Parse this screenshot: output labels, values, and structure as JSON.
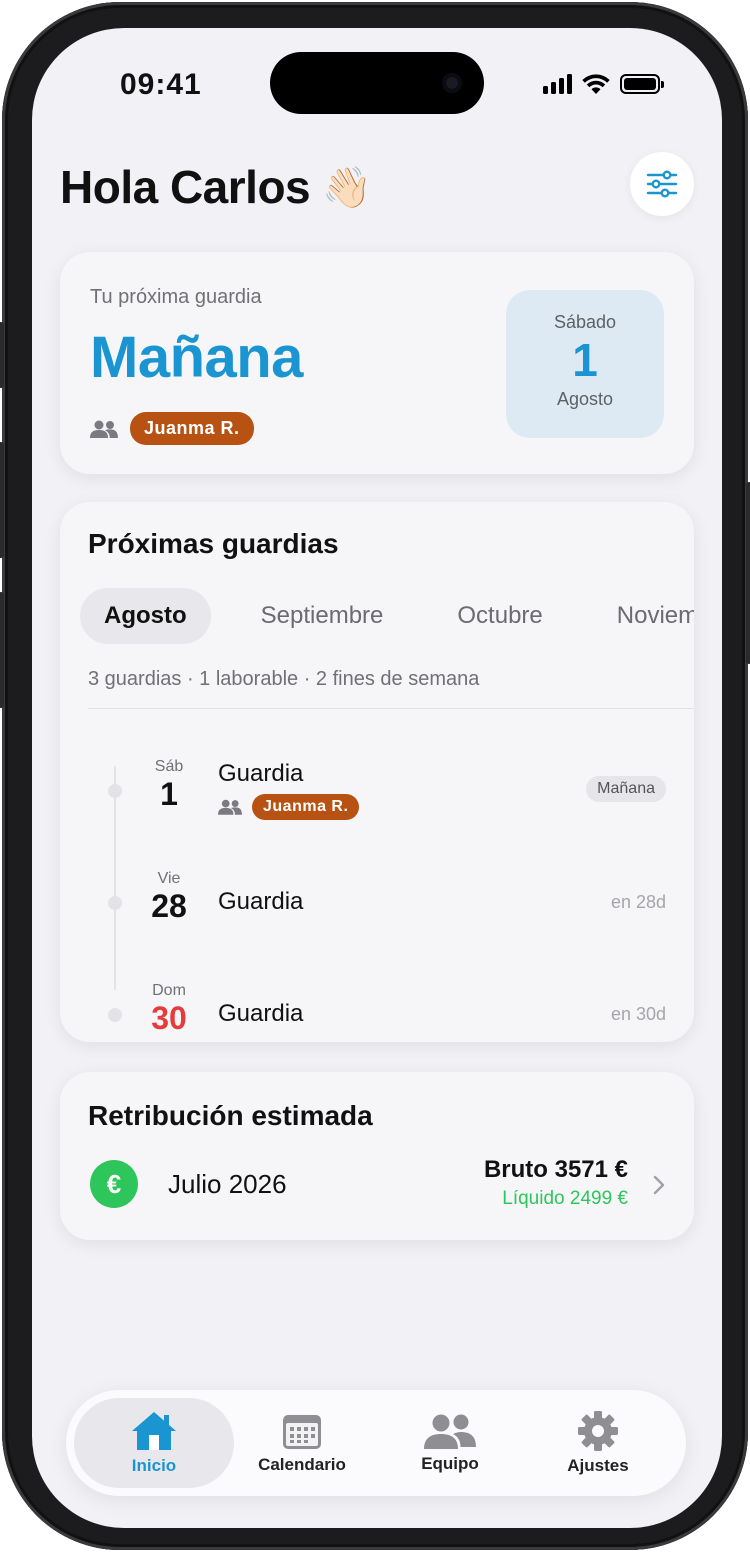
{
  "status": {
    "time": "09:41"
  },
  "header": {
    "greeting": "Hola Carlos",
    "wave_emoji": "👋🏻",
    "filter_icon": "sliders-icon"
  },
  "next_shift": {
    "label": "Tu próxima guardia",
    "when": "Mañana",
    "partner": "Juanma R.",
    "day_of_week": "Sábado",
    "day": "1",
    "month": "Agosto"
  },
  "upcoming": {
    "title": "Próximas guardias",
    "tabs": [
      "Agosto",
      "Septiembre",
      "Octubre",
      "Noviembre"
    ],
    "active_tab": "Agosto",
    "summary": "3 guardias · 1 laborable · 2 fines de semana",
    "items": [
      {
        "dow": "Sáb",
        "day": "1",
        "title": "Guardia",
        "partner": "Juanma R.",
        "tag": "Mañana"
      },
      {
        "dow": "Vie",
        "day": "28",
        "title": "Guardia",
        "relative": "en 28d"
      },
      {
        "dow": "Dom",
        "day": "30",
        "title": "Guardia",
        "relative": "en 30d"
      }
    ]
  },
  "retribution": {
    "title": "Retribución estimada",
    "symbol": "€",
    "month": "Julio 2026",
    "gross": "Bruto 3571 €",
    "net": "Líquido 2499 €"
  },
  "tabbar": [
    {
      "label": "Inicio",
      "icon": "home-icon",
      "active": true
    },
    {
      "label": "Calendario",
      "icon": "calendar-icon",
      "active": false
    },
    {
      "label": "Equipo",
      "icon": "team-icon",
      "active": false
    },
    {
      "label": "Ajustes",
      "icon": "gear-icon",
      "active": false
    }
  ],
  "colors": {
    "accent": "#1a95d1",
    "partner_pill": "#b75213",
    "success": "#2ec55a",
    "weekend": "#e53b3b"
  }
}
